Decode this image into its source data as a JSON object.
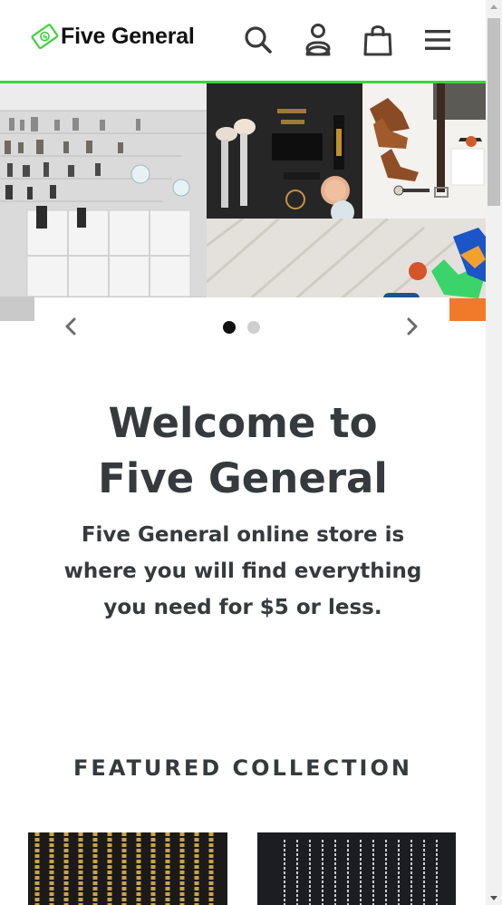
{
  "header": {
    "logo_text": "Five General",
    "logo_icon": "dollar-bill-icon",
    "accent_color": "#3bd43b",
    "icons": [
      "search-icon",
      "account-icon",
      "cart-icon",
      "menu-icon"
    ]
  },
  "slideshow": {
    "slides_count": 2,
    "active_slide": 1,
    "prev_icon": "chevron-left-icon",
    "next_icon": "chevron-right-icon"
  },
  "welcome": {
    "title_line1": "Welcome to",
    "title_line2": "Five General",
    "text": "Five General online store is where you will find everything you need for $5 or less."
  },
  "featured": {
    "title": "FEATURED COLLECTION",
    "products": [
      "gold-chains-image",
      "silver-chains-image"
    ]
  }
}
